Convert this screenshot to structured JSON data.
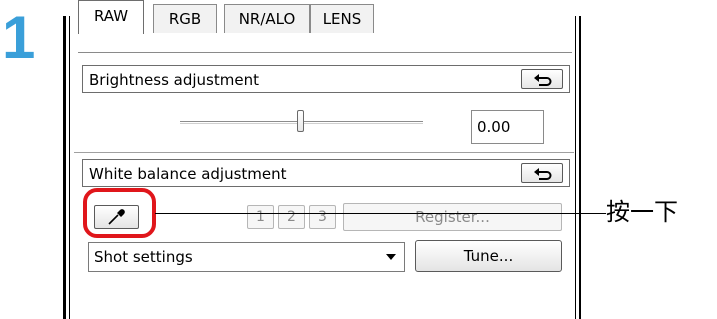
{
  "step": {
    "number": "1"
  },
  "tabs": [
    {
      "label": "RAW",
      "active": true
    },
    {
      "label": "RGB",
      "active": false
    },
    {
      "label": "NR/ALO",
      "active": false
    },
    {
      "label": "LENS",
      "active": false
    }
  ],
  "brightness": {
    "title": "Brightness adjustment",
    "value": "0.00",
    "slider_fraction": 0.48
  },
  "white_balance": {
    "title": "White balance adjustment",
    "custom_buttons": [
      "1",
      "2",
      "3"
    ],
    "register_label": "Register...",
    "shot_settings_value": "Shot settings",
    "tune_label": "Tune..."
  },
  "callout": {
    "text": "按一下"
  },
  "colors": {
    "step_number": "#3a9fd9",
    "highlight": "#e0161b"
  },
  "icons": {
    "reset": "reset-arrow-icon",
    "eyedropper": "eyedropper-icon"
  }
}
